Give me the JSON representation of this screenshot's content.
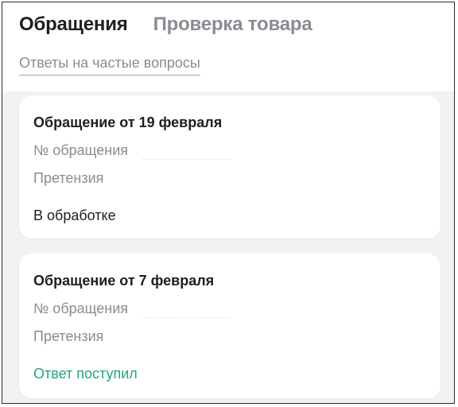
{
  "tabs": [
    {
      "label": "Обращения",
      "active": true
    },
    {
      "label": "Проверка товара",
      "active": false
    }
  ],
  "faq_link": "Ответы на частые вопросы",
  "cards": [
    {
      "title": "Обращение от 19 февраля",
      "number_label": "№ обращения",
      "type": "Претензия",
      "status": "В обработке"
    },
    {
      "title": "Обращение от 7 февраля",
      "number_label": "№ обращения",
      "type": "Претензия",
      "status": "Ответ поступил"
    }
  ],
  "colors": {
    "answered_status": "#22a67a",
    "muted_text": "#8b8b93",
    "primary_text": "#1f1f1f",
    "background": "#f2f2f2"
  }
}
